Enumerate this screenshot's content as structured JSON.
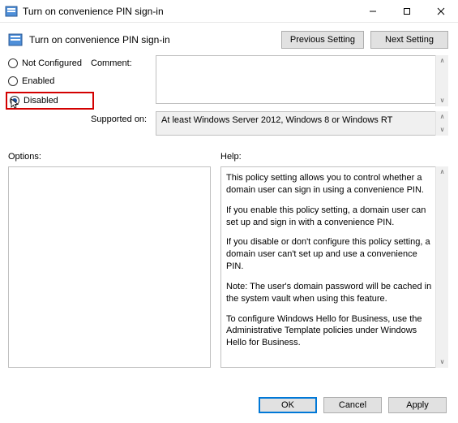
{
  "titlebar": {
    "title": "Turn on convenience PIN sign-in"
  },
  "header": {
    "title": "Turn on convenience PIN sign-in",
    "previous": "Previous Setting",
    "next": "Next Setting"
  },
  "radios": {
    "not_configured": "Not Configured",
    "enabled": "Enabled",
    "disabled": "Disabled"
  },
  "labels": {
    "comment": "Comment:",
    "supported": "Supported on:",
    "options": "Options:",
    "help": "Help:"
  },
  "supported_text": "At least Windows Server 2012, Windows 8 or Windows RT",
  "help": {
    "p1": "This policy setting allows you to control whether a domain user can sign in using a convenience PIN.",
    "p2": "If you enable this policy setting, a domain user can set up and sign in with a convenience PIN.",
    "p3": "If you disable or don't configure this policy setting, a domain user can't set up and use a convenience PIN.",
    "p4": "Note: The user's domain password will be cached in the system vault when using this feature.",
    "p5": "To configure Windows Hello for Business, use the Administrative Template policies under Windows Hello for Business."
  },
  "buttons": {
    "ok": "OK",
    "cancel": "Cancel",
    "apply": "Apply"
  }
}
